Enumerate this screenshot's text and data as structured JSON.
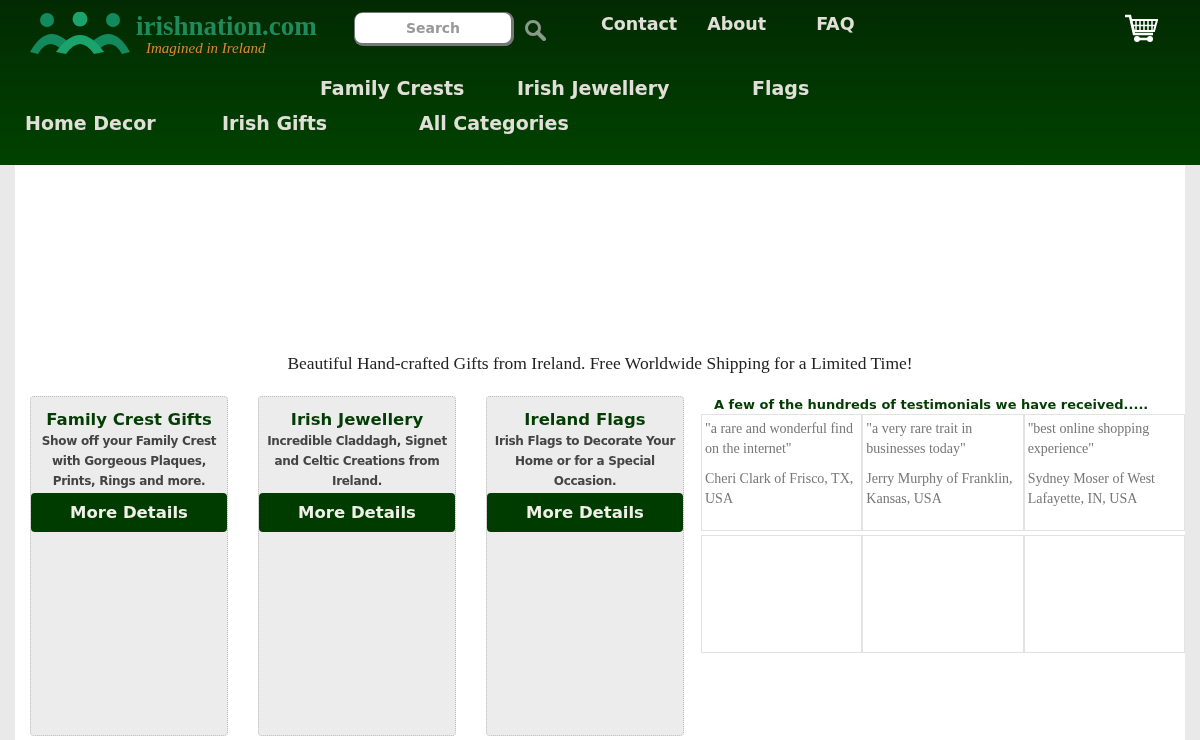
{
  "logo": {
    "name": "irishnation.com",
    "tagline": "Imagined in Ireland"
  },
  "search": {
    "placeholder": "Search"
  },
  "top_nav": [
    "Contact",
    "About",
    "FAQ"
  ],
  "category_nav": [
    "Family Crests",
    "Irish Jewellery",
    "Flags",
    "Home Decor",
    "Irish Gifts",
    "All Categories"
  ],
  "banner_text": "Beautiful Hand-crafted Gifts from Ireland. Free Worldwide Shipping for a Limited Time!",
  "cards": [
    {
      "title": "Family Crest Gifts",
      "description": "Show off your Family Crest with Gorgeous Plaques, Prints, Rings and more.",
      "button": "More Details"
    },
    {
      "title": "Irish Jewellery",
      "description": "Incredible Claddagh, Signet and Celtic Creations from Ireland.",
      "button": "More Details"
    },
    {
      "title": "Ireland Flags",
      "description": "Irish Flags to Decorate Your Home or for a Special Occasion.",
      "button": "More Details"
    }
  ],
  "testimonials": {
    "heading": "A few of the hundreds of testimonials we have received.....",
    "items": [
      {
        "quote": "\"a rare and wonderful find on the internet\"",
        "author": "Cheri Clark of Frisco, TX, USA"
      },
      {
        "quote": "\"a very rare trait in businesses today\"",
        "author": "Jerry Murphy of Franklin, Kansas, USA"
      },
      {
        "quote": "\"best online shopping experience\"",
        "author": "Sydney Moser of West Lafayette, IN, USA"
      }
    ]
  }
}
